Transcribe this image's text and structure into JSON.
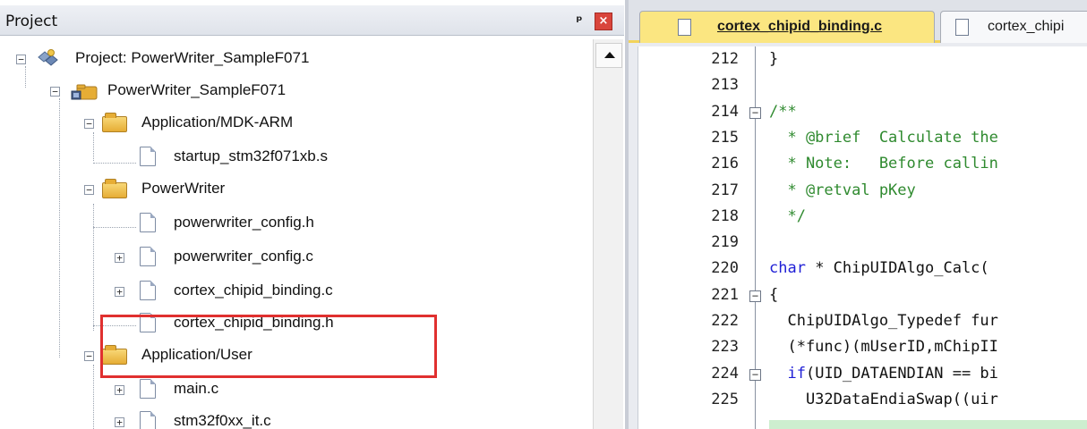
{
  "project_panel": {
    "title": "Project",
    "pin_glyph": "ᵖ",
    "close_glyph": "×",
    "tree": [
      {
        "label": "Project: PowerWriter_SampleF071",
        "icon": "project-icon",
        "expander": "−"
      },
      {
        "label": "PowerWriter_SampleF071",
        "icon": "target-group-icon",
        "expander": "−"
      },
      {
        "label": "Application/MDK-ARM",
        "icon": "folder-icon",
        "expander": "−"
      },
      {
        "label": "startup_stm32f071xb.s",
        "icon": "file-icon",
        "expander": ""
      },
      {
        "label": "PowerWriter",
        "icon": "folder-icon",
        "expander": "−"
      },
      {
        "label": "powerwriter_config.h",
        "icon": "file-icon",
        "expander": ""
      },
      {
        "label": "powerwriter_config.c",
        "icon": "file-icon",
        "expander": "+"
      },
      {
        "label": "cortex_chipid_binding.c",
        "icon": "file-icon",
        "expander": "+"
      },
      {
        "label": "cortex_chipid_binding.h",
        "icon": "file-icon",
        "expander": ""
      },
      {
        "label": "Application/User",
        "icon": "folder-icon",
        "expander": "−"
      },
      {
        "label": "main.c",
        "icon": "file-icon",
        "expander": "+"
      },
      {
        "label": "stm32f0xx_it.c",
        "icon": "file-icon",
        "expander": "+"
      }
    ]
  },
  "editor": {
    "tabs": [
      {
        "label": "cortex_chipid_binding.c",
        "active": true
      },
      {
        "label": "cortex_chipi",
        "active": false
      }
    ],
    "lines": [
      {
        "num": "212",
        "code": "}",
        "kind": "plain",
        "fold": ""
      },
      {
        "num": "213",
        "code": "",
        "kind": "plain",
        "fold": ""
      },
      {
        "num": "214",
        "code": "/**",
        "kind": "comment",
        "fold": "−"
      },
      {
        "num": "215",
        "code": "  * @brief  Calculate the",
        "kind": "comment",
        "fold": ""
      },
      {
        "num": "216",
        "code": "  * Note:   Before callin",
        "kind": "comment",
        "fold": ""
      },
      {
        "num": "217",
        "code": "  * @retval pKey",
        "kind": "comment",
        "fold": ""
      },
      {
        "num": "218",
        "code": "  */",
        "kind": "comment",
        "fold": ""
      },
      {
        "num": "219",
        "code": "",
        "kind": "plain",
        "fold": ""
      },
      {
        "num": "220",
        "code": "char * ChipUIDAlgo_Calc(",
        "kind": "decl",
        "fold": ""
      },
      {
        "num": "221",
        "code": "{",
        "kind": "plain",
        "fold": "−"
      },
      {
        "num": "222",
        "code": "  ChipUIDAlgo_Typedef fur",
        "kind": "plain",
        "fold": ""
      },
      {
        "num": "223",
        "code": "  (*func)(mUserID,mChipII",
        "kind": "plain",
        "fold": ""
      },
      {
        "num": "224",
        "code": "  if(UID_DATAENDIAN == bi",
        "kind": "if",
        "fold": "−"
      },
      {
        "num": "225",
        "code": "    U32DataEndiaSwap((uir",
        "kind": "plain",
        "fold": ""
      }
    ]
  },
  "colors": {
    "comment": "#2f8a2f",
    "keyword": "#1f1fd6",
    "highlight_box": "#e0302f",
    "active_tab": "#fbe681"
  }
}
